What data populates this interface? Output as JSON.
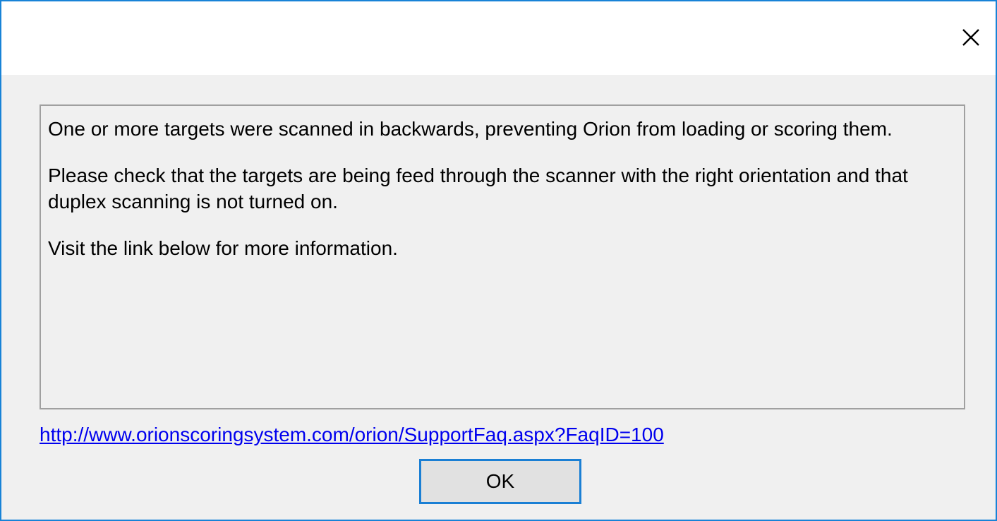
{
  "dialog": {
    "close_icon": "close-icon",
    "message": {
      "paragraph_1": "One or more targets were scanned in backwards, preventing Orion from loading or scoring them.",
      "paragraph_2": "Please check that the targets are being feed through the scanner with the right orientation and that duplex scanning is not turned on.",
      "paragraph_3": "Visit the link below for more information."
    },
    "link_text": "http://www.orionscoringsystem.com/orion/SupportFaq.aspx?FaqID=100",
    "ok_label": "OK"
  },
  "colors": {
    "accent_border": "#1883d7",
    "link": "#0000ee",
    "dialog_bg": "#f0f0f0"
  }
}
